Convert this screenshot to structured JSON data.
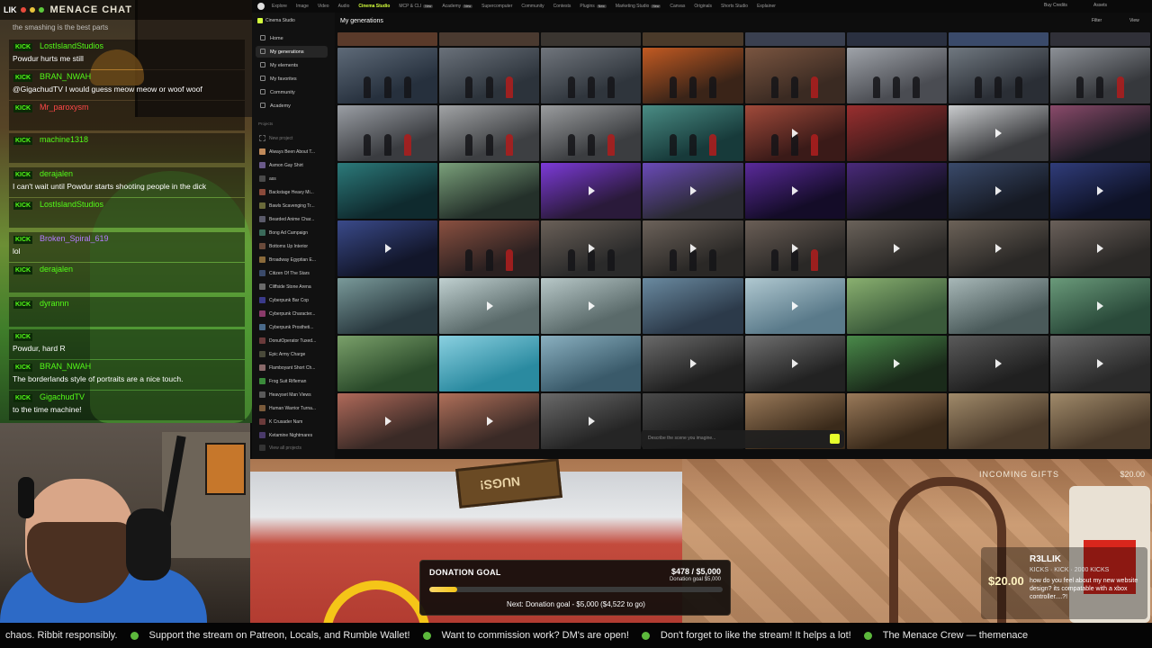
{
  "chat": {
    "logo": "LIK",
    "title": "MENACE CHAT",
    "snippet": "the smashing is the best parts",
    "badge": "KICK",
    "messages": [
      {
        "user": "LostIslandStudios",
        "color": "#53fc18",
        "text": "Powdur hurts me still"
      },
      {
        "user": "BRAN_NWAH",
        "color": "#53fc18",
        "text": "@GigachudTV I would guess meow meow or woof woof"
      },
      {
        "user": "Mr_paroxysm",
        "color": "#ff4848",
        "text": ""
      },
      {
        "user": "machine1318",
        "color": "#53fc18",
        "text": ""
      },
      {
        "user": "derajalen",
        "color": "#53fc18",
        "text": "I can't wait until Powdur starts shooting people in the dick"
      },
      {
        "user": "LostIslandStudios",
        "color": "#53fc18",
        "text": ""
      },
      {
        "user": "Broken_Spiral_619",
        "color": "#b47cff",
        "text": "lol"
      },
      {
        "user": "derajalen",
        "color": "#53fc18",
        "text": ""
      },
      {
        "user": "dyrannn",
        "color": "#53fc18",
        "text": ""
      },
      {
        "user": "",
        "color": "#53fc18",
        "text": "Powdur, hard R"
      },
      {
        "user": "BRAN_NWAH",
        "color": "#53fc18",
        "text": "The borderlands style of portraits are a nice touch."
      },
      {
        "user": "GigachudTV",
        "color": "#53fc18",
        "text": "to the time machine!"
      }
    ]
  },
  "browser": {
    "nav": [
      "Explore",
      "Image",
      "Video",
      "Audio",
      "Cinema Studio",
      "MCP & CLI",
      "Academy",
      "Supercomputer",
      "Community",
      "Contests",
      "Plugins",
      "Marketing Studio",
      "Canvas",
      "Originals",
      "Shorts Studio",
      "Explainer"
    ],
    "nav_active": "Cinema Studio",
    "new_tag": "New",
    "buy_credits": "Buy Credits",
    "assets": "Assets",
    "sidebar_title": "Cinema Studio",
    "sidebar_nav": [
      "Home",
      "My generations",
      "My elements",
      "My favorites",
      "Community",
      "Academy"
    ],
    "projects_label": "Projects",
    "new_project": "New project",
    "projects": [
      "Always Been About T...",
      "Asmon Gay Shirt",
      "ass",
      "Backstage Heavy Mi...",
      "Bawls Scavenging Tr...",
      "Bearded Anime Char...",
      "Bong Ad Campaign",
      "Bottoms Up Interior",
      "Broadway Egyptian E...",
      "Citizen Of The Stars",
      "Cliffside Stone Arena",
      "Cyberpunk Bar Cop",
      "Cyberpunk Character...",
      "Cyberpunk Prostheti...",
      "DonutOperator Tuxed...",
      "Epic Army Charge",
      "Flamboyant Short Ch...",
      "Frog Suit Rifleman",
      "Heavyset Man Views",
      "Human Warrior Turna...",
      "K Crusader Nam",
      "Ketamine Nightmares"
    ],
    "view_all": "View all projects",
    "main_title": "My generations",
    "filter": "Filter",
    "view": "View",
    "prompt_placeholder": "Describe the scene you imagine..."
  },
  "scene": {
    "sign_text": "NUGS!",
    "gifts_label": "INCOMING GIFTS",
    "gifts_amount": "$20.00",
    "gift": {
      "amount": "$20.00",
      "user": "R3LLIK",
      "meta": "KICKS · KICK · 2000 KICKS",
      "note": "how do you feel about my new website design? its compatable with a xbox controller....?!"
    },
    "donation": {
      "title": "DONATION GOAL",
      "amount": "$478 / $5,000",
      "sub": "Donation goal $5,000",
      "progress": 0.0956,
      "next": "Next: Donation goal - $5,000 ($4,522 to go)"
    }
  },
  "ticker": [
    "chaos. Ribbit responsibly.",
    "Support the stream on Patreon, Locals, and Rumble Wallet!",
    "Want to commission work? DM's are open!",
    "Don't forget to like the stream! It helps a lot!",
    "The Menace Crew — themenace"
  ],
  "grid": {
    "columns": 8,
    "rows": [
      {
        "top": [
          "#5a3a2a",
          "#4a3a30",
          "#3a3530",
          "#4a3a2a",
          "#3a4050",
          "#2a3040",
          "#3a4a6a",
          "#303038"
        ],
        "tiles": [
          [
            "#26303d",
            "#5e6a78"
          ],
          [
            "#2c333b",
            "#6a717a"
          ],
          [
            "#2f353c",
            "#70757c"
          ],
          [
            "#3a2418",
            "#c25a22"
          ],
          [
            "#3a2a22",
            "#7a5540"
          ],
          [
            "#4a4c52",
            "#9fa3a9"
          ],
          [
            "#2a2e35",
            "#707880"
          ],
          [
            "#36383c",
            "#8c9096"
          ]
        ]
      },
      {
        "tiles": [
          [
            "#3a3c40",
            "#9a9ea4"
          ],
          [
            "#3d3f42",
            "#a1a3a5"
          ],
          [
            "#3b3d40",
            "#9a9c9e"
          ],
          [
            "#173a3a",
            "#4a8c84"
          ],
          [
            "#3a1a18",
            "#a04a3a"
          ],
          [
            "#3a1a1a",
            "#9a2f2f"
          ],
          [
            "#3a3b3e",
            "#c9cbcd"
          ],
          [
            "#1a1a22",
            "#8a4a6a"
          ]
        ]
      },
      {
        "tiles": [
          [
            "#0f2a2e",
            "#2c7a7a"
          ],
          [
            "#24302a",
            "#7aa07a"
          ],
          [
            "#2a1a3a",
            "#7c3ad8"
          ],
          [
            "#2a2a32",
            "#6a4ab8"
          ],
          [
            "#140c28",
            "#5a2a9a"
          ],
          [
            "#12101e",
            "#4a2a7a"
          ],
          [
            "#161a24",
            "#3a4a6a"
          ],
          [
            "#0e1226",
            "#303c7a"
          ]
        ]
      },
      {
        "tiles": [
          [
            "#12162a",
            "#3a4a8a"
          ],
          [
            "#2a2020",
            "#8a5040"
          ],
          [
            "#2a2a2a",
            "#6a6058"
          ],
          [
            "#2a2826",
            "#6c625a"
          ],
          [
            "#2a2826",
            "#6a5e56"
          ],
          [
            "#2a2826",
            "#6a625a"
          ],
          [
            "#2a2826",
            "#6c6258"
          ],
          [
            "#2a2826",
            "#6a605a"
          ]
        ]
      },
      {
        "tiles": [
          [
            "#2a3a40",
            "#7a9a9a"
          ],
          [
            "#5a6a6a",
            "#c0d0d0"
          ],
          [
            "#5a6a6a",
            "#b8c8c8"
          ],
          [
            "#2c3a4a",
            "#6a8aa0"
          ],
          [
            "#5a7a8a",
            "#b0c8d0"
          ],
          [
            "#3a5a3a",
            "#8ab070"
          ],
          [
            "#4a5a5a",
            "#a8b8b8"
          ],
          [
            "#2a4a3a",
            "#6a9a7a"
          ]
        ]
      },
      {
        "tiles": [
          [
            "#2a4a2a",
            "#7aa06a"
          ],
          [
            "#2a8aa0",
            "#8ad0e0"
          ],
          [
            "#3a5a6a",
            "#8ab0c0"
          ],
          [
            "#202020",
            "#6a6a6a"
          ],
          [
            "#222222",
            "#707070"
          ],
          [
            "#1a2a1a",
            "#4a8a4a"
          ],
          [
            "#202020",
            "#5a5a5a"
          ],
          [
            "#2a2a2a",
            "#6a6a6a"
          ]
        ]
      },
      {
        "tiles": [
          [
            "#3a2a26",
            "#b06a5a"
          ],
          [
            "#3a2a26",
            "#b0705a"
          ],
          [
            "#252525",
            "#6a6a6a"
          ],
          [
            "#181818",
            "#4a4a4a"
          ],
          [
            "#3a2a1a",
            "#9a7a5a"
          ],
          [
            "#3a2a1a",
            "#9a7a5a"
          ],
          [
            "#4a3a2a",
            "#a08a6a"
          ],
          [
            "#4a3a2a",
            "#a08a6a"
          ]
        ]
      }
    ]
  }
}
